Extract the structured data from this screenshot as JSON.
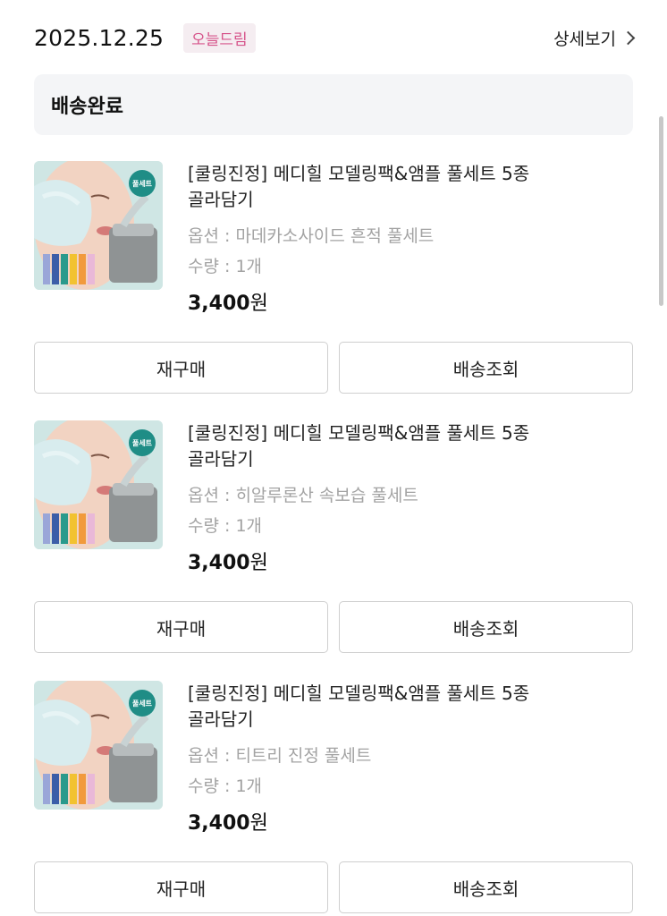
{
  "header": {
    "date": "2025.12.25",
    "badge": "오늘드림",
    "detail_label": "상세보기"
  },
  "status": {
    "label": "배송완료"
  },
  "items": [
    {
      "name": "[쿨링진정] 메디힐 모델링팩&앰플 풀세트 5종 골라담기",
      "option": "옵션 : 마데카소사이드 흔적 풀세트",
      "quantity": "수량 : 1개",
      "price": "3,400",
      "currency": "원",
      "thumb_badge": "풀세트",
      "rebuy_label": "재구매",
      "track_label": "배송조회"
    },
    {
      "name": "[쿨링진정] 메디힐 모델링팩&앰플 풀세트 5종 골라담기",
      "option": "옵션 : 히알루론산 속보습 풀세트",
      "quantity": "수량 : 1개",
      "price": "3,400",
      "currency": "원",
      "thumb_badge": "풀세트",
      "rebuy_label": "재구매",
      "track_label": "배송조회"
    },
    {
      "name": "[쿨링진정] 메디힐 모델링팩&앰플 풀세트 5종 골라담기",
      "option": "옵션 : 티트리 진정 풀세트",
      "quantity": "수량 : 1개",
      "price": "3,400",
      "currency": "원",
      "thumb_badge": "풀세트",
      "rebuy_label": "재구매",
      "track_label": "배송조회"
    }
  ],
  "colors": {
    "badge_bg": "#f5edf1",
    "badge_text": "#d6538a",
    "status_bg": "#f4f5f7",
    "muted_text": "#a3a3a3",
    "button_border": "#cfcfcf"
  }
}
